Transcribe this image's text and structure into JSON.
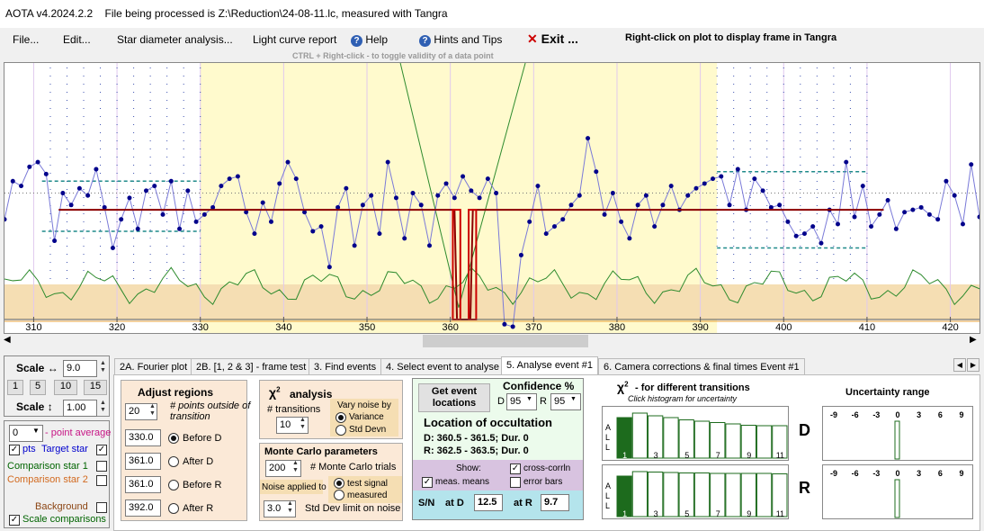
{
  "title_bar": {
    "app": "AOTA v4.2024.2.2",
    "text": "File being processed is Z:\\Reduction\\24-08-11.lc, measured with Tangra"
  },
  "menu": {
    "file": "File...",
    "edit": "Edit...",
    "star_diameter": "Star diameter analysis...",
    "light_curve": "Light curve report",
    "help": "Help",
    "hints": "Hints and Tips",
    "exit": "Exit ...",
    "right_click_note": "Right-click on plot to display frame in Tangra"
  },
  "plot_hint": "CTRL + Right-click  -  to toggle validity of a data point",
  "plot": {
    "x_ticks": [
      "310",
      "320",
      "330",
      "340",
      "350",
      "360",
      "370",
      "380",
      "390",
      "400",
      "410",
      "420"
    ],
    "x_range": [
      306.5,
      423.5
    ],
    "values": [
      0.42,
      0.58,
      0.56,
      0.64,
      0.66,
      0.61,
      0.33,
      0.53,
      0.48,
      0.55,
      0.52,
      0.63,
      0.47,
      0.3,
      0.42,
      0.51,
      0.38,
      0.54,
      0.56,
      0.44,
      0.58,
      0.38,
      0.54,
      0.41,
      0.44,
      0.47,
      0.56,
      0.59,
      0.6,
      0.45,
      0.36,
      0.49,
      0.41,
      0.57,
      0.66,
      0.59,
      0.45,
      0.37,
      0.39,
      0.22,
      0.47,
      0.55,
      0.31,
      0.48,
      0.52,
      0.36,
      0.66,
      0.51,
      0.34,
      0.53,
      0.48,
      0.31,
      0.52,
      0.57,
      0.51,
      0.6,
      0.54,
      0.51,
      0.59,
      0.53,
      -0.02,
      -0.03,
      0.27,
      0.41,
      0.56,
      0.36,
      0.39,
      0.42,
      0.48,
      0.52,
      0.76,
      0.62,
      0.44,
      0.53,
      0.41,
      0.34,
      0.48,
      0.52,
      0.39,
      0.48,
      0.56,
      0.46,
      0.52,
      0.55,
      0.57,
      0.59,
      0.6,
      0.48,
      0.63,
      0.46,
      0.59,
      0.54,
      0.47,
      0.48,
      0.41,
      0.35,
      0.36,
      0.39,
      0.32,
      0.46,
      0.4,
      0.66,
      0.43,
      0.56,
      0.39,
      0.44,
      0.5,
      0.38,
      0.45,
      0.46,
      0.47,
      0.44,
      0.42,
      0.58,
      0.52,
      0.4,
      0.65,
      0.43,
      0.47,
      0.35,
      0.32,
      0.42,
      0.51,
      0.3,
      0.3
    ],
    "baseline": 0.46,
    "event_bottom": 0.0
  },
  "scale_panel": {
    "scale_h_label": "Scale ↔",
    "scale_h_value": "9.0",
    "buttons": [
      "1",
      "5",
      "10",
      "15"
    ],
    "scale_v_label": "Scale ↕",
    "scale_v_value": "1.00",
    "point_avg_value": "0",
    "point_avg_label": "- point average",
    "pts_label": "pts",
    "target_label": "Target star",
    "comp1_label": "Comparison star 1",
    "comp2_label": "Comparison star 2",
    "background_label": "Background",
    "scale_comp_label": "Scale comparisons"
  },
  "tabs": [
    "2A. Fourier plot",
    "2B. [1, 2 & 3] - frame test",
    "3. Find events",
    "4. Select event to analyse",
    "5. Analyse event #1",
    "6. Camera corrections & final times Event #1"
  ],
  "adjust": {
    "title": "Adjust regions",
    "points_value": "20",
    "points_label": "# points outside of transition",
    "rows": [
      {
        "value": "330.0",
        "label": "Before D"
      },
      {
        "value": "361.0",
        "label": "After D"
      },
      {
        "value": "361.0",
        "label": "Before R"
      },
      {
        "value": "392.0",
        "label": "After R"
      }
    ]
  },
  "chi": {
    "title": "analysis",
    "transitions_label": "# transitions",
    "transitions_value": "10",
    "vary_label": "Vary noise by",
    "variance": "Variance",
    "stddev": "Std Devn"
  },
  "monte": {
    "title": "Monte Carlo parameters",
    "trials_value": "200",
    "trials_label": "# Monte Carlo trials",
    "noise_label": "Noise applied to",
    "test_signal": "test signal",
    "measured": "measured",
    "std_value": "3.0",
    "std_label": "Std Dev limit on noise"
  },
  "location": {
    "get_events": "Get event locations",
    "confidence_label": "Confidence %",
    "d_label": "D",
    "d_value": "95",
    "r_label": "R",
    "r_value": "95",
    "title": "Location of occultation",
    "d_line": "D: 360.5 - 361.5; Dur. 0",
    "r_line": "R: 362.5 - 363.5; Dur. 0",
    "show_label": "Show:",
    "cross_corr": "cross-corrln",
    "meas_means": "meas. means",
    "error_bars": "error bars",
    "sn_label": "S/N",
    "at_d_label": "at D",
    "at_d_value": "12.5",
    "at_r_label": "at R",
    "at_r_value": "9.7"
  },
  "hist": {
    "title": "- for different transitions",
    "subtitle": "Click histogram for uncertainty",
    "side_letters": [
      "A",
      "L",
      "L"
    ],
    "d_label": "D",
    "r_label": "R",
    "d_bars": [
      0.9,
      1.0,
      0.94,
      0.9,
      0.85,
      0.82,
      0.79,
      0.76,
      0.73,
      0.72,
      0.72
    ],
    "r_bars": [
      0.9,
      1.0,
      0.99,
      0.98,
      0.97,
      0.97,
      0.96,
      0.96,
      0.96,
      0.96,
      0.95
    ],
    "tick_labels": [
      "1",
      "3",
      "5",
      "7",
      "9",
      "11"
    ]
  },
  "uncertainty": {
    "title": "Uncertainty range",
    "ticks": [
      "-9",
      "-6",
      "-3",
      "0",
      "3",
      "6",
      "9"
    ]
  },
  "colors": {
    "accent": "#cc0000",
    "hist_fill": "#1d6b1d",
    "blue_series": "#00008b",
    "beige": "#f5deb3",
    "cream": "#fffacd"
  }
}
